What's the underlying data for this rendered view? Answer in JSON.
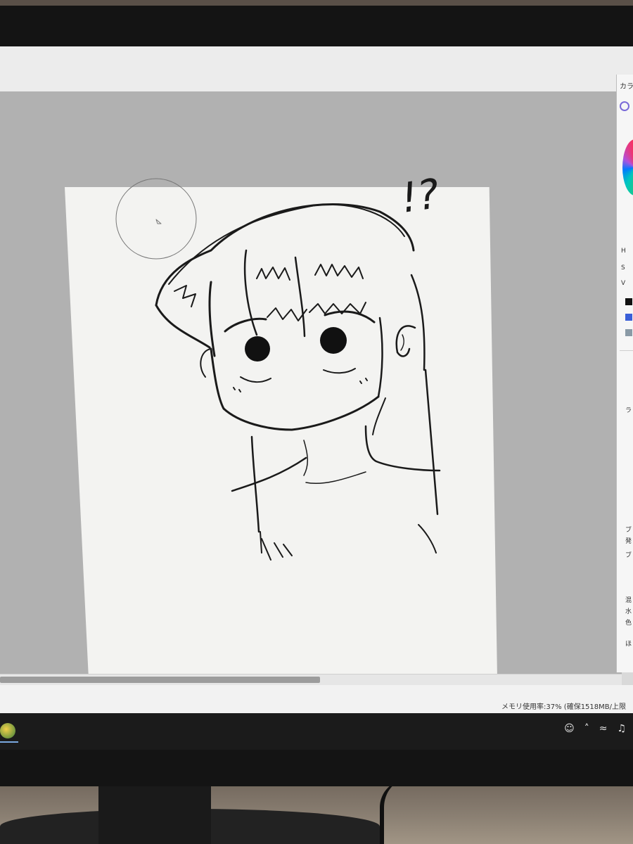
{
  "app": {
    "side_panel_title": "カラ",
    "hsv_labels": [
      "H",
      "S",
      "V"
    ],
    "panel_glyphs": [
      "ラ",
      "ブ",
      "発",
      "ブ",
      "混",
      "水",
      "色",
      "ほ"
    ],
    "status_text": "メモリ使用率:37% (確保1518MB/上限"
  },
  "canvas": {
    "annotation_text": "!?"
  },
  "colors": {
    "workspace": "#b1b1b1",
    "paper": "#f3f3f1",
    "ink": "#1a1a1a",
    "taskbar": "#1b1b1b"
  },
  "icons": {
    "taskbar_app": "app-icon",
    "tray": [
      "people-icon",
      "chevron-up-icon",
      "wifi-icon",
      "speaker-icon"
    ]
  }
}
